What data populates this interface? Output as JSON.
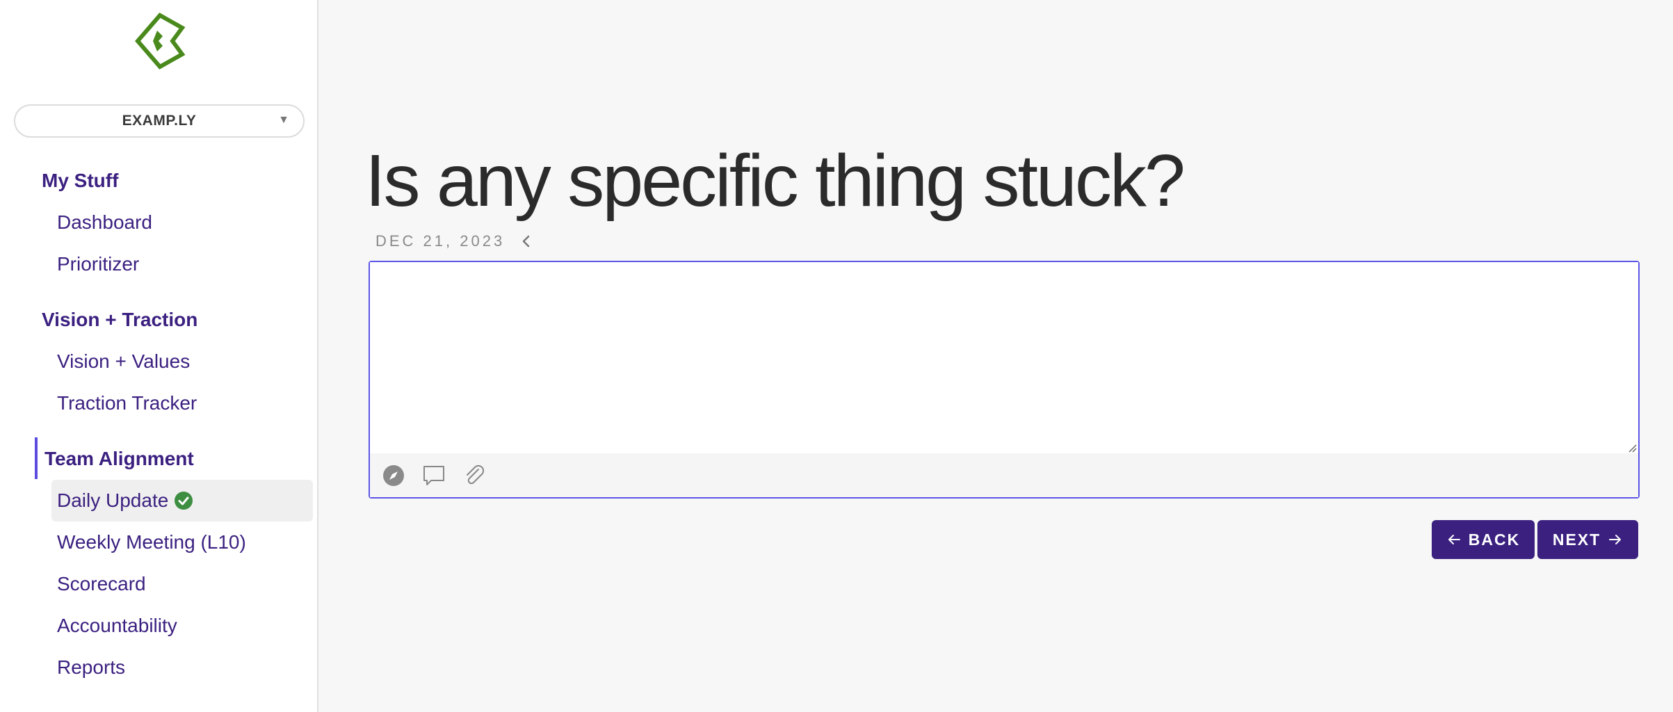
{
  "org": {
    "name": "EXAMP.LY"
  },
  "sidebar": {
    "sections": [
      {
        "title": "My Stuff",
        "items": [
          {
            "label": "Dashboard"
          },
          {
            "label": "Prioritizer"
          }
        ]
      },
      {
        "title": "Vision + Traction",
        "items": [
          {
            "label": "Vision + Values"
          },
          {
            "label": "Traction Tracker"
          }
        ]
      },
      {
        "title": "Team Alignment",
        "items": [
          {
            "label": "Daily Update",
            "active": true,
            "status_icon": "check-circle-icon"
          },
          {
            "label": "Weekly Meeting (L10)"
          },
          {
            "label": "Scorecard"
          },
          {
            "label": "Accountability"
          },
          {
            "label": "Reports"
          }
        ]
      }
    ]
  },
  "main": {
    "title": "Is any specific thing stuck?",
    "date": "DEC 21, 2023",
    "editor": {
      "value": "",
      "toolbar_icons": [
        "compass-icon",
        "comment-icon",
        "paperclip-icon"
      ]
    }
  },
  "buttons": {
    "back": "BACK",
    "next": "NEXT"
  },
  "colors": {
    "accent": "#3b2080",
    "focus_border": "#5b55e6",
    "success": "#3e8e41",
    "logo": "#4a8a1c"
  }
}
